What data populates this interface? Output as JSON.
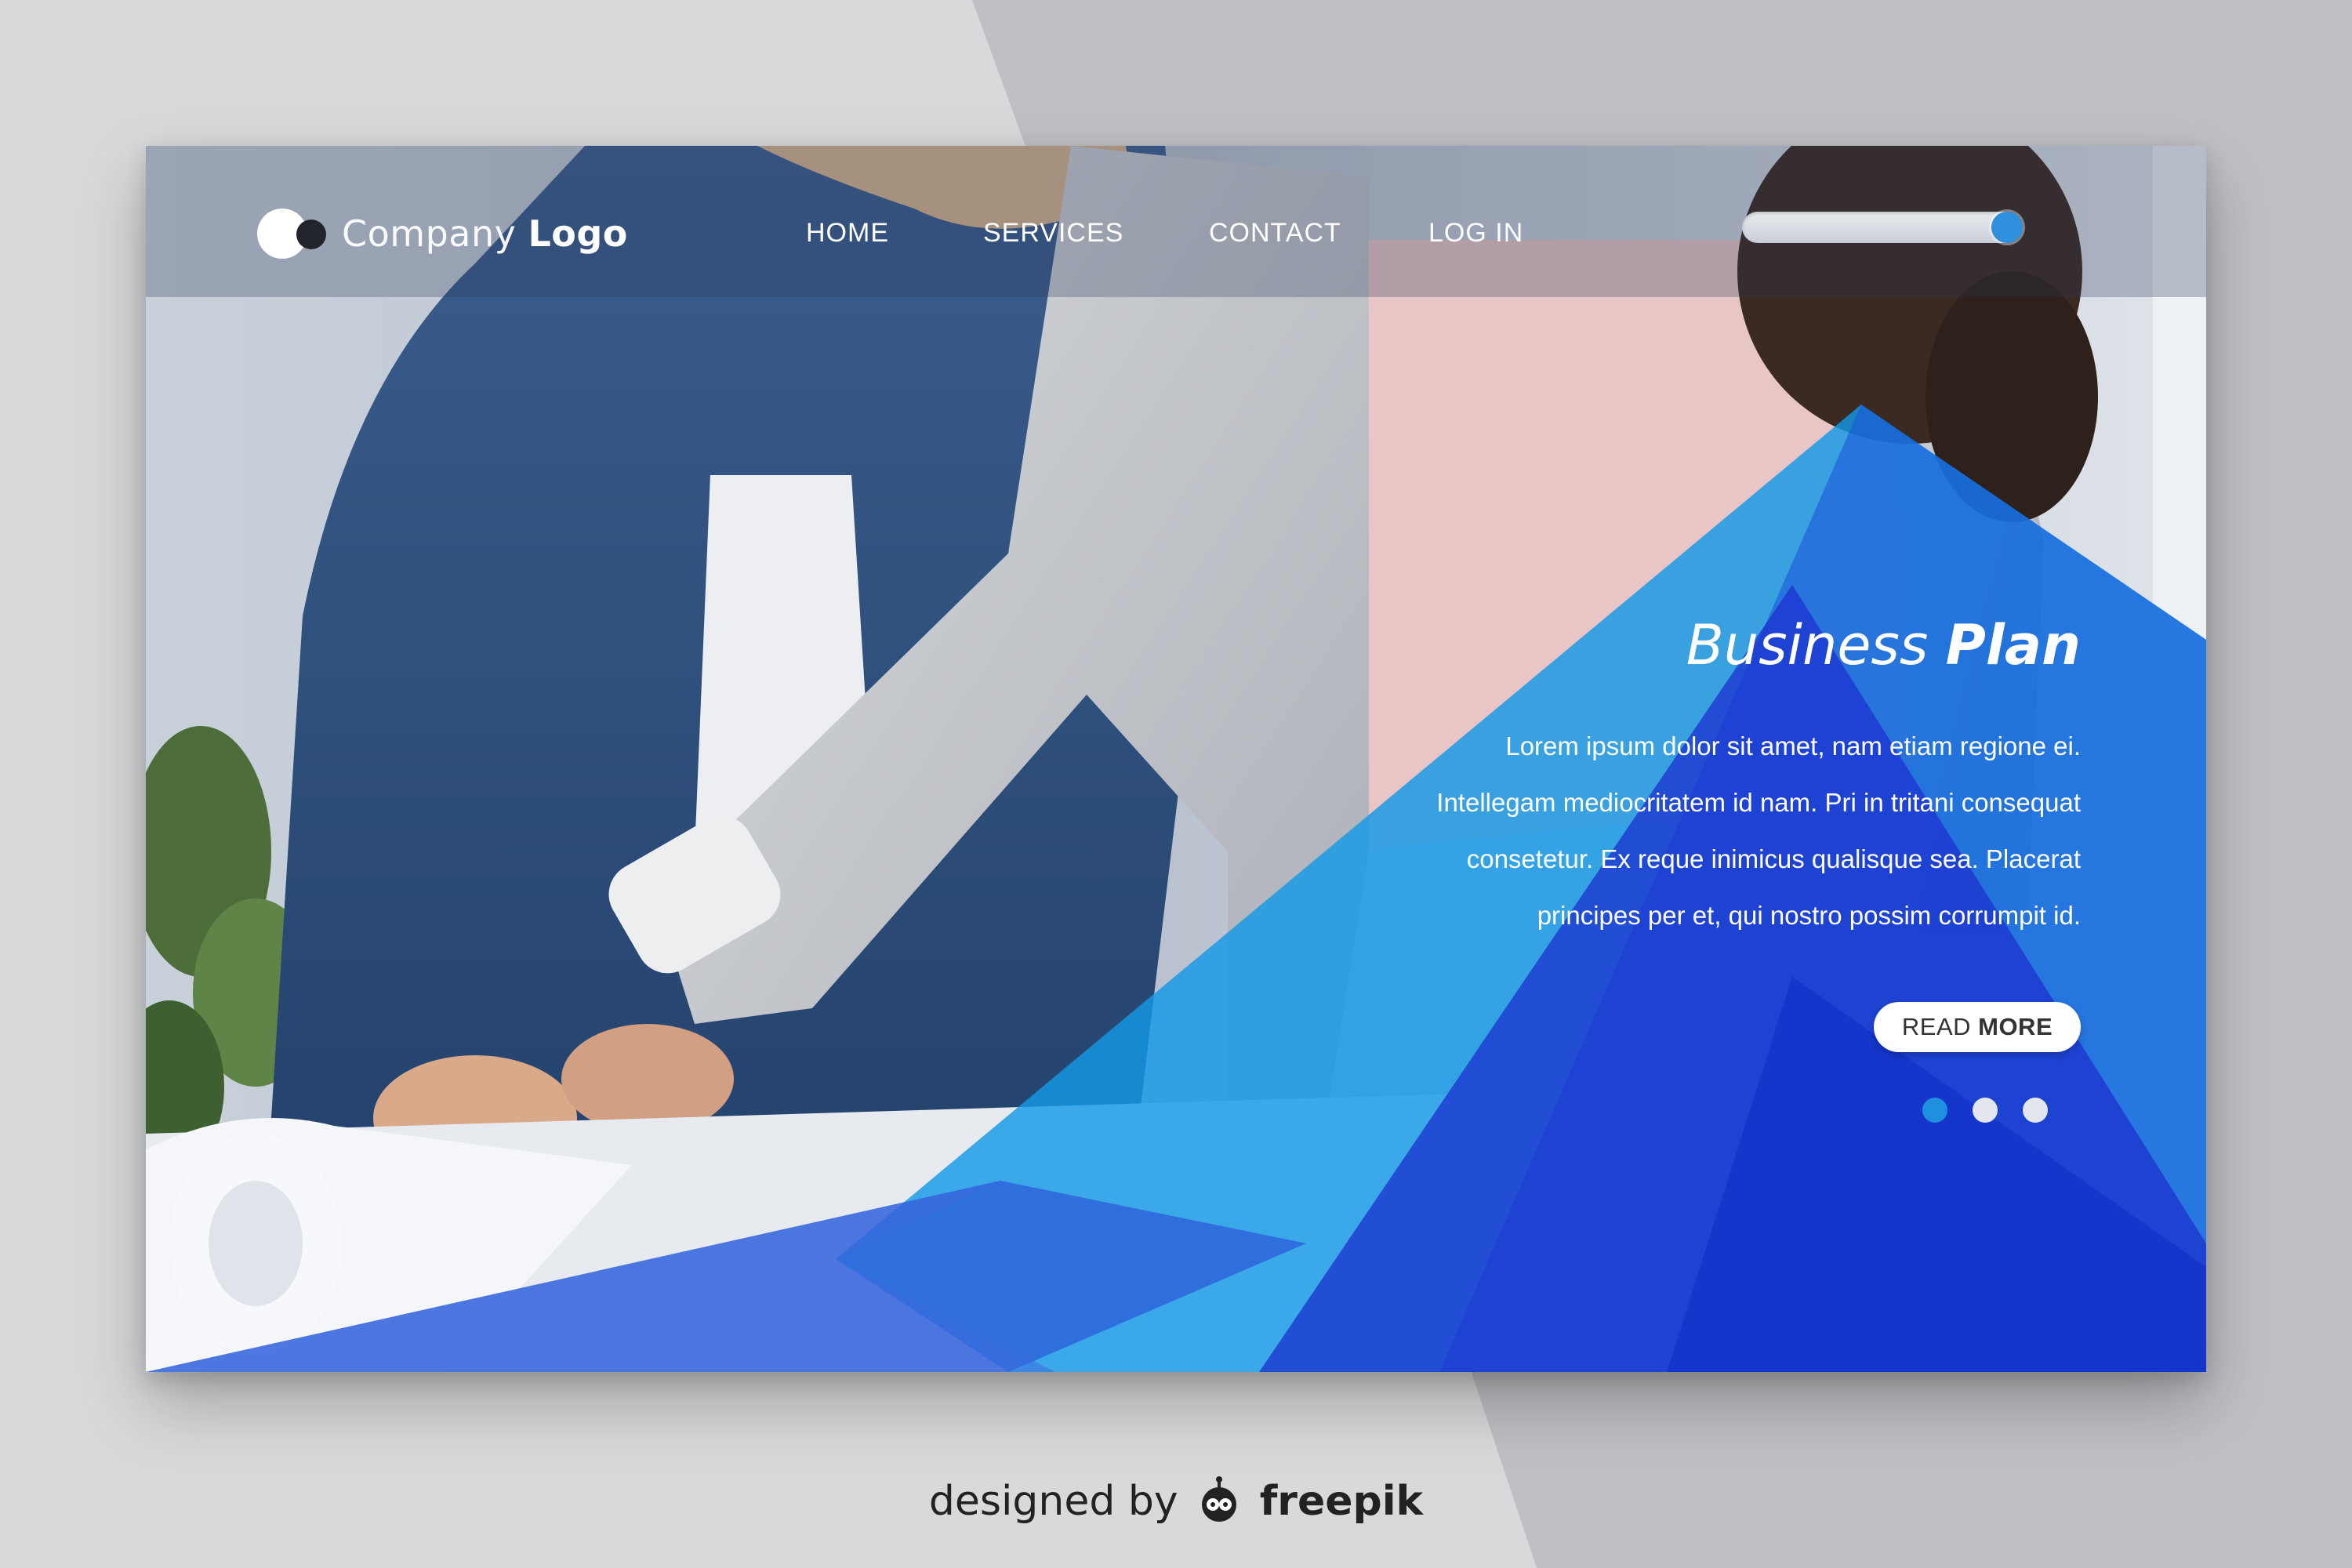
{
  "brand": {
    "light": "Company ",
    "bold": "Logo"
  },
  "nav": [
    {
      "label": "HOME"
    },
    {
      "label": "SERVICES"
    },
    {
      "label": "CONTACT"
    },
    {
      "label": "LOG IN"
    }
  ],
  "hero": {
    "title_light": "Business ",
    "title_bold": "Plan",
    "body_lines": [
      "Lorem ipsum dolor sit amet, nam etiam regione ei.",
      "Intellegam mediocritatem id nam. Pri in tritani consequat",
      "consetetur. Ex reque inimicus qualisque sea. Placerat",
      "principes per et, qui nostro possim corrumpit id."
    ],
    "cta_light": "READ ",
    "cta_bold": "MORE"
  },
  "slider": {
    "count": 3,
    "active_index": 0
  },
  "credit": {
    "prefix": "designed by",
    "brand": "freepik"
  },
  "colors": {
    "accent": "#1f8fe0",
    "triangle_dark": "#1a3fd6",
    "triangle_light": "#1499e6",
    "page_bg": "#d6d7d9"
  },
  "icons": {
    "logo": "two-circles-logo-icon",
    "credit": "freepik-robot-icon"
  }
}
